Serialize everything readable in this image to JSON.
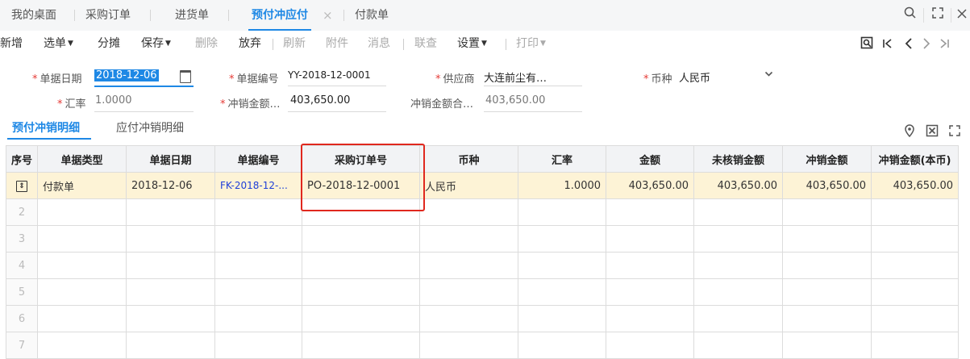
{
  "tabs": [
    {
      "label": "我的桌面"
    },
    {
      "label": "采购订单"
    },
    {
      "label": "进货单"
    },
    {
      "label": "预付冲应付",
      "active": true
    },
    {
      "label": "付款单"
    }
  ],
  "tab_close_glyph": "×",
  "window_controls": {
    "search": "search-icon",
    "restore": "restore-icon",
    "close": "close-icon"
  },
  "toolbar": {
    "new": "新增",
    "select": "选单",
    "split": "分摊",
    "save": "保存",
    "delete": "删除",
    "abandon": "放弃",
    "refresh": "刷新",
    "attachment": "附件",
    "message": "消息",
    "link_query": "联查",
    "settings": "设置",
    "print": "打印"
  },
  "nav_icons": [
    "preview-icon",
    "first-page-icon",
    "prev-page-icon",
    "next-page-icon",
    "last-page-icon"
  ],
  "form": {
    "doc_date_label": "单据日期",
    "doc_date_value": "2018-12-06",
    "doc_no_label": "单据编号",
    "doc_no_value": "YY-2018-12-0001",
    "supplier_label": "供应商",
    "supplier_value": "大连前尘有…",
    "currency_label": "币种",
    "currency_value": "人民币",
    "rate_label": "汇率",
    "rate_value": "1.0000",
    "writeoff_amount_label": "冲销金额…",
    "writeoff_amount_value": "403,650.00",
    "writeoff_total_label": "冲销金额合…",
    "writeoff_total_value": "403,650.00"
  },
  "sub_tabs": {
    "prepay": "预付冲销明细",
    "payable": "应付冲销明细"
  },
  "grid": {
    "columns": [
      "序号",
      "单据类型",
      "单据日期",
      "单据编号",
      "采购订单号",
      "币种",
      "汇率",
      "金额",
      "未核销金额",
      "冲销金额",
      "冲销金额(本币)"
    ],
    "rows": [
      {
        "type": "付款单",
        "date": "2018-12-06",
        "doc_no": "FK-2018-12-...",
        "po_no": "PO-2018-12-0001",
        "currency": "人民币",
        "rate": "1.0000",
        "amount": "403,650.00",
        "unsettled": "403,650.00",
        "writeoff": "403,650.00",
        "writeoff_local": "403,650.00"
      }
    ],
    "empty_row_numbers": [
      "2",
      "3",
      "4",
      "5",
      "6",
      "7"
    ]
  },
  "colors": {
    "accent": "#1e88e5",
    "highlight_row": "#fdf3d6",
    "annotation_box": "#e0281e",
    "required": "#e53935"
  }
}
